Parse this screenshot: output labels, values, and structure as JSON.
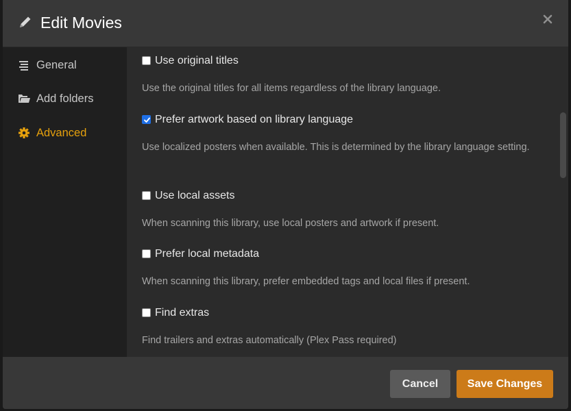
{
  "header": {
    "icon": "pencil-icon",
    "title": "Edit Movies",
    "close_icon": "close-icon"
  },
  "sidebar": {
    "items": [
      {
        "label": "General",
        "icon": "align-lines-icon",
        "active": false
      },
      {
        "label": "Add folders",
        "icon": "folder-icon",
        "active": false
      },
      {
        "label": "Advanced",
        "icon": "gear-icon",
        "active": true
      }
    ]
  },
  "settings": [
    {
      "label": "Use original titles",
      "checked": false,
      "description": "Use the original titles for all items regardless of the library language."
    },
    {
      "label": "Prefer artwork based on library language",
      "checked": true,
      "description": "Use localized posters when available. This is determined by the library language setting."
    },
    {
      "label": "Use local assets",
      "checked": false,
      "description": "When scanning this library, use local posters and artwork if present."
    },
    {
      "label": "Prefer local metadata",
      "checked": false,
      "description": "When scanning this library, prefer embedded tags and local files if present."
    },
    {
      "label": "Find extras",
      "checked": false,
      "description": "Find trailers and extras automatically (Plex Pass required)"
    }
  ],
  "footer": {
    "cancel_label": "Cancel",
    "save_label": "Save Changes"
  },
  "colors": {
    "accent": "#e5a00d",
    "save_button": "#cc7b19",
    "checkbox_checked": "#1e6fe6"
  }
}
